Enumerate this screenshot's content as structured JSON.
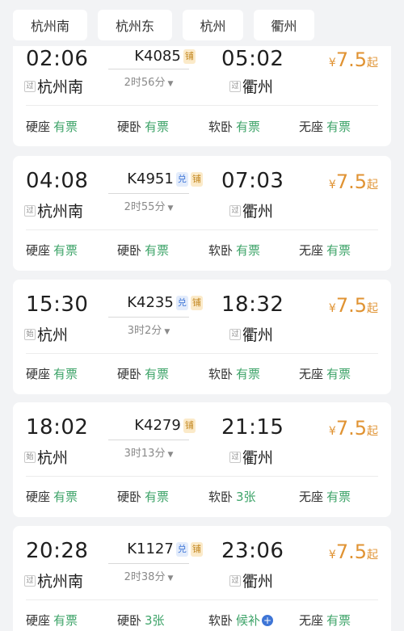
{
  "filters": [
    "杭州南",
    "杭州东",
    "杭州",
    "衢州"
  ],
  "trains": [
    {
      "train_no": "K4085",
      "badges": [
        "铺"
      ],
      "dep_time": "02:06",
      "dep_tag": "过",
      "dep_station": "杭州南",
      "arr_time": "05:02",
      "arr_tag": "过",
      "arr_station": "衢州",
      "duration": "2时56分",
      "price": "7.5",
      "currency": "¥",
      "price_suffix": "起",
      "seats": [
        {
          "type": "硬座",
          "status": "有票"
        },
        {
          "type": "硬卧",
          "status": "有票"
        },
        {
          "type": "软卧",
          "status": "有票"
        },
        {
          "type": "无座",
          "status": "有票"
        }
      ]
    },
    {
      "train_no": "K4951",
      "badges": [
        "兑",
        "铺"
      ],
      "dep_time": "04:08",
      "dep_tag": "过",
      "dep_station": "杭州南",
      "arr_time": "07:03",
      "arr_tag": "过",
      "arr_station": "衢州",
      "duration": "2时55分",
      "price": "7.5",
      "currency": "¥",
      "price_suffix": "起",
      "seats": [
        {
          "type": "硬座",
          "status": "有票"
        },
        {
          "type": "硬卧",
          "status": "有票"
        },
        {
          "type": "软卧",
          "status": "有票"
        },
        {
          "type": "无座",
          "status": "有票"
        }
      ]
    },
    {
      "train_no": "K4235",
      "badges": [
        "兑",
        "铺"
      ],
      "dep_time": "15:30",
      "dep_tag": "始",
      "dep_station": "杭州",
      "arr_time": "18:32",
      "arr_tag": "过",
      "arr_station": "衢州",
      "duration": "3时2分",
      "price": "7.5",
      "currency": "¥",
      "price_suffix": "起",
      "seats": [
        {
          "type": "硬座",
          "status": "有票"
        },
        {
          "type": "硬卧",
          "status": "有票"
        },
        {
          "type": "软卧",
          "status": "有票"
        },
        {
          "type": "无座",
          "status": "有票"
        }
      ]
    },
    {
      "train_no": "K4279",
      "badges": [
        "铺"
      ],
      "dep_time": "18:02",
      "dep_tag": "始",
      "dep_station": "杭州",
      "arr_time": "21:15",
      "arr_tag": "过",
      "arr_station": "衢州",
      "duration": "3时13分",
      "price": "7.5",
      "currency": "¥",
      "price_suffix": "起",
      "seats": [
        {
          "type": "硬座",
          "status": "有票"
        },
        {
          "type": "硬卧",
          "status": "有票"
        },
        {
          "type": "软卧",
          "status": "3张"
        },
        {
          "type": "无座",
          "status": "有票"
        }
      ]
    },
    {
      "train_no": "K1127",
      "badges": [
        "兑",
        "铺"
      ],
      "dep_time": "20:28",
      "dep_tag": "过",
      "dep_station": "杭州南",
      "arr_time": "23:06",
      "arr_tag": "过",
      "arr_station": "衢州",
      "duration": "2时38分",
      "price": "7.5",
      "currency": "¥",
      "price_suffix": "起",
      "seats": [
        {
          "type": "硬座",
          "status": "有票"
        },
        {
          "type": "硬卧",
          "status": "3张"
        },
        {
          "type": "软卧",
          "status": "候补",
          "plus": true
        },
        {
          "type": "无座",
          "status": "有票"
        }
      ]
    }
  ],
  "colors": {
    "available": "#3fa46a",
    "price": "#e09333",
    "badge_dui_bg": "#e3ecfb",
    "badge_pu_bg": "#fbeac9",
    "plus_icon": "#3e75d6"
  },
  "icons": [
    "chevron-down-icon",
    "plus-circle-icon"
  ]
}
